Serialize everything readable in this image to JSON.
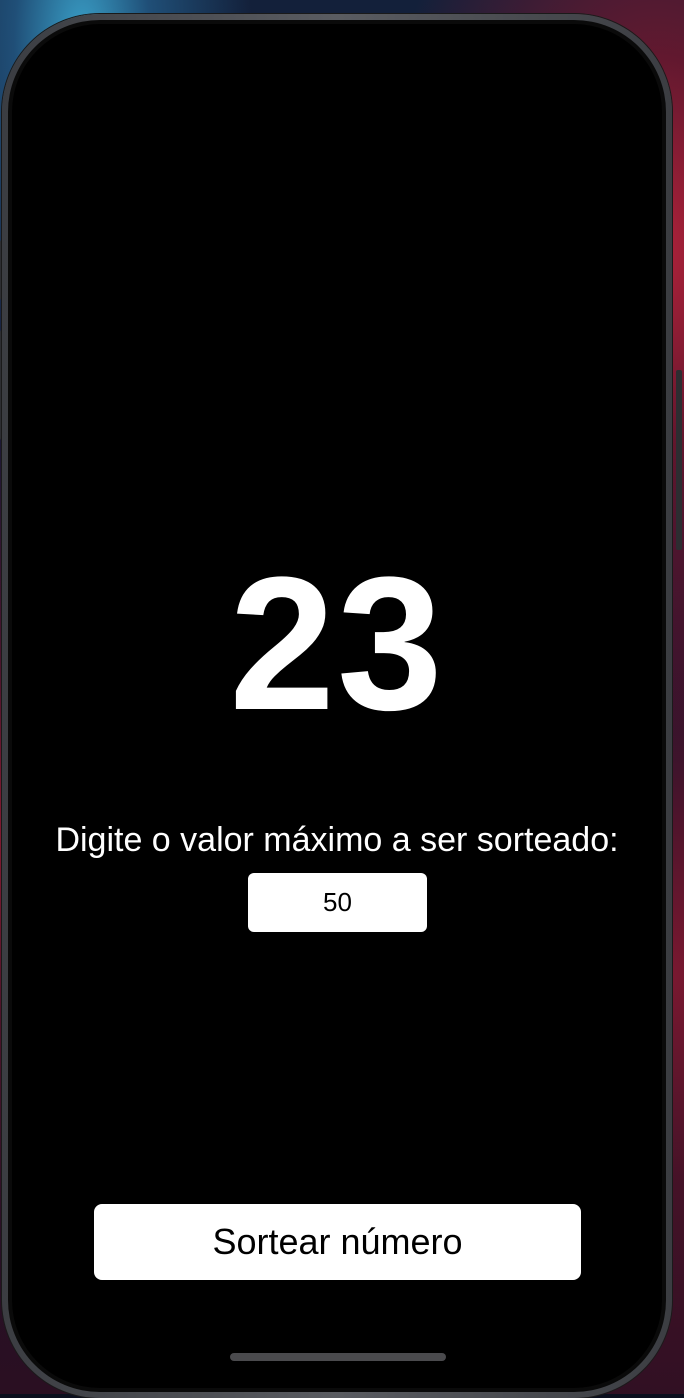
{
  "app": {
    "result_number": "23",
    "prompt_label": "Digite o valor máximo a ser sorteado:",
    "max_input": {
      "value": "50",
      "placeholder": ""
    },
    "draw_button_label": "Sortear número"
  },
  "colors": {
    "screen_background": "#000000",
    "text": "#ffffff",
    "control_background": "#ffffff",
    "control_text": "#000000"
  }
}
